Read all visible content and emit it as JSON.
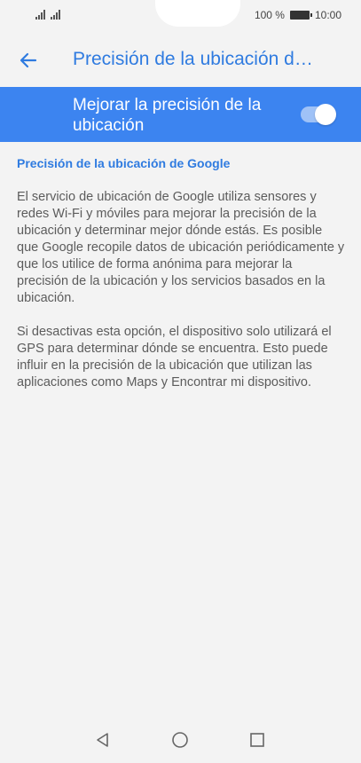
{
  "status_bar": {
    "battery_percent": "100 %",
    "time": "10:00",
    "icons": [
      "signal-icon",
      "signal-icon",
      "battery-icon"
    ]
  },
  "header": {
    "title": "Precisión de la ubicación d…",
    "back_icon": "arrow-left-icon"
  },
  "setting": {
    "label": "Mejorar la precisión de la ubicación",
    "enabled": true,
    "accent_color": "#3c84f0"
  },
  "content": {
    "heading": "Precisión de la ubicación de Google",
    "paragraph_1": "El servicio de ubicación de Google utiliza sensores y redes Wi-Fi y móviles para mejorar la precisión de la ubicación y determinar mejor dónde estás. Es posible que Google recopile datos de ubicación periódicamente y que los utilice de forma anónima para mejorar la precisión de la ubicación y los servicios basados en la ubicación.",
    "paragraph_2": "Si desactivas esta opción, el dispositivo solo utilizará el GPS para determinar dónde se encuentra. Esto puede influir en la precisión de la ubicación que utilizan las aplicaciones como Maps y Encontrar mi dispositivo."
  },
  "nav_bar": {
    "icons": [
      "back-triangle-icon",
      "home-circle-icon",
      "recents-square-icon"
    ]
  }
}
